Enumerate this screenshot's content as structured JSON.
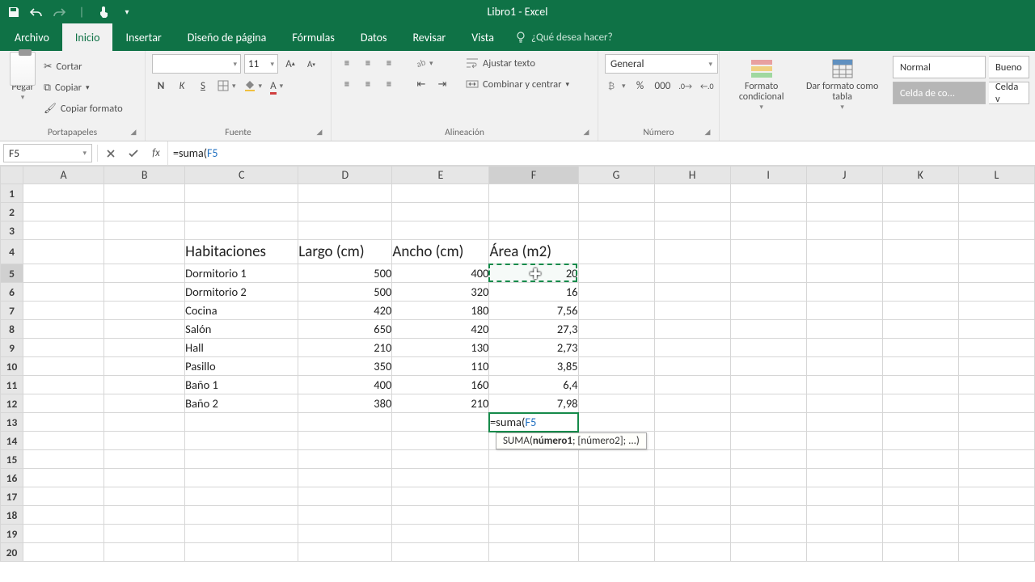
{
  "window": {
    "title": "Libro1 - Excel"
  },
  "tabs": {
    "archivo": "Archivo",
    "inicio": "Inicio",
    "insertar": "Insertar",
    "disenoPagina": "Diseño de página",
    "formulas": "Fórmulas",
    "datos": "Datos",
    "revisar": "Revisar",
    "vista": "Vista",
    "tellMe": "¿Qué desea hacer?"
  },
  "ribbon": {
    "clipboard": {
      "paste": "Pegar",
      "cut": "Cortar",
      "copy": "Copiar",
      "formatPainter": "Copiar formato",
      "groupLabel": "Portapapeles"
    },
    "font": {
      "size": "11",
      "groupLabel": "Fuente",
      "bold": "N",
      "italic": "K",
      "underline": "S"
    },
    "alignment": {
      "wrap": "Ajustar texto",
      "merge": "Combinar y centrar",
      "groupLabel": "Alineación"
    },
    "number": {
      "format": "General",
      "groupLabel": "Número"
    },
    "styles": {
      "conditional": "Formato condicional",
      "asTable": "Dar formato como tabla",
      "normal": "Normal",
      "bueno": "Bueno",
      "celdaCo": "Celda de co...",
      "celdaV": "Celda v"
    }
  },
  "formulaBar": {
    "nameBox": "F5",
    "formulaPrefix": "=suma(",
    "formulaRef": "F5"
  },
  "columns": [
    "A",
    "B",
    "C",
    "D",
    "E",
    "F",
    "G",
    "H",
    "I",
    "J",
    "K",
    "L"
  ],
  "rowCount": 20,
  "headersRow": {
    "C": "Habitaciones",
    "D": "Largo (cm)",
    "E": "Ancho (cm)",
    "F": "Área (m2)"
  },
  "data": [
    {
      "room": "Dormitorio 1",
      "largo": "500",
      "ancho": "400",
      "area": "20"
    },
    {
      "room": "Dormitorio 2",
      "largo": "500",
      "ancho": "320",
      "area": "16"
    },
    {
      "room": "Cocina",
      "largo": "420",
      "ancho": "180",
      "area": "7,56"
    },
    {
      "room": "Salón",
      "largo": "650",
      "ancho": "420",
      "area": "27,3"
    },
    {
      "room": "Hall",
      "largo": "210",
      "ancho": "130",
      "area": "2,73"
    },
    {
      "room": "Pasillo",
      "largo": "350",
      "ancho": "110",
      "area": "3,85"
    },
    {
      "room": "Baño 1",
      "largo": "400",
      "ancho": "160",
      "area": "6,4"
    },
    {
      "room": "Baño 2",
      "largo": "380",
      "ancho": "210",
      "area": "7,98"
    }
  ],
  "editingCell": {
    "text": "=suma(",
    "ref": "F5"
  },
  "tooltip": {
    "func": "SUMA",
    "arg1": "número1",
    "rest": "; [número2]; ...)"
  }
}
